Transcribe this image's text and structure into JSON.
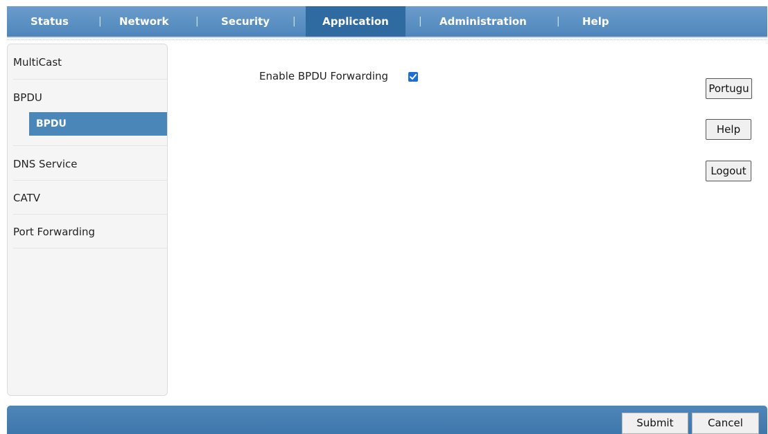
{
  "topnav": {
    "tabs": [
      {
        "label": "Status"
      },
      {
        "label": "Network"
      },
      {
        "label": "Security"
      },
      {
        "label": "Application",
        "active": true
      },
      {
        "label": "Administration"
      },
      {
        "label": "Help"
      }
    ],
    "separator": "|"
  },
  "sidebar": {
    "items": [
      {
        "label": "MultiCast"
      },
      {
        "label": "BPDU"
      },
      {
        "label": "DNS Service"
      },
      {
        "label": "CATV"
      },
      {
        "label": "Port Forwarding"
      }
    ],
    "subitem": {
      "label": "BPDU",
      "selected": true
    }
  },
  "main": {
    "enable_bpdu_label": "Enable BPDU Forwarding",
    "enable_bpdu_checked": true
  },
  "side_buttons": {
    "language": "Portugu",
    "help": "Help",
    "logout": "Logout"
  },
  "bottom": {
    "submit": "Submit",
    "cancel": "Cancel"
  },
  "colors": {
    "nav_bar": "#5a8fc2",
    "nav_active": "#2f6aa0",
    "sidebar_selected": "#4a86b8",
    "checkbox": "#1d6fd6",
    "bottom_bar": "#4a80b3"
  }
}
